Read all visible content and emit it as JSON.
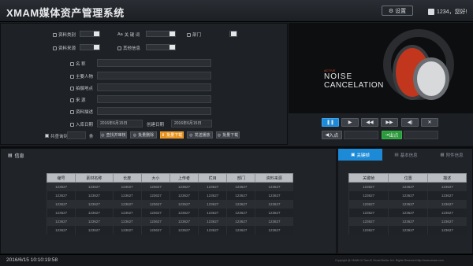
{
  "header": {
    "title": "XMAM媒体资产管理系统",
    "settings_label": "设置",
    "user_label": "1234，您好!"
  },
  "filters": {
    "type_label": "资料类别",
    "keyword_label": "关 键 词",
    "department_label": "部门",
    "source_label": "资料来源",
    "other_label": "其他信息"
  },
  "fields": [
    {
      "label": "名    称",
      "icon": "name-icon"
    },
    {
      "label": "主要人物",
      "icon": "person-icon"
    },
    {
      "label": "拍摄地点",
      "icon": "location-icon"
    },
    {
      "label": "来    源",
      "icon": "source-icon"
    },
    {
      "label": "资料描述",
      "icon": "description-icon"
    }
  ],
  "date": {
    "label": "入库日期",
    "from": "2016年6月15日",
    "to_label": "创建日期",
    "to": "2016年6月15日"
  },
  "summary": {
    "label": "共查询到",
    "unit": "条"
  },
  "actions": [
    "查找并审核",
    "批量删除",
    "批量下载",
    "发送播放",
    "批量下载"
  ],
  "video": {
    "overlay_small": "ACTIVE",
    "overlay_line1": "NOISE",
    "overlay_line2": "CANCELATION"
  },
  "controls": {
    "in_label": "入点",
    "out_label": "出点"
  },
  "info": {
    "title": "信息",
    "columns": [
      "编号",
      "素材名称",
      "长度",
      "大小",
      "上传者",
      "栏目",
      "部门",
      "资料来源"
    ],
    "rows": [
      [
        "123627",
        "123627",
        "123627",
        "123627",
        "123627",
        "123627",
        "123627",
        "123627"
      ],
      [
        "123627",
        "123627",
        "123627",
        "123627",
        "123627",
        "123627",
        "123627",
        "123627"
      ],
      [
        "123627",
        "123627",
        "123627",
        "123627",
        "123627",
        "123627",
        "123627",
        "123627"
      ],
      [
        "123627",
        "123627",
        "123627",
        "123627",
        "123627",
        "123627",
        "123627",
        "123627"
      ],
      [
        "123627",
        "123627",
        "123627",
        "123627",
        "123627",
        "123627",
        "123627",
        "123627"
      ],
      [
        "123627",
        "123627",
        "123627",
        "123627",
        "123627",
        "123627",
        "123627",
        "123627"
      ]
    ]
  },
  "right": {
    "tabs": [
      "关键帧",
      "基本信息",
      "附件信息"
    ],
    "columns": [
      "关键帧",
      "位置",
      "描述"
    ],
    "rows": [
      [
        "123627",
        "123627",
        "123627"
      ],
      [
        "123627",
        "123627",
        "123627"
      ],
      [
        "123627",
        "123627",
        "123627"
      ],
      [
        "123627",
        "123627",
        "123627"
      ],
      [
        "123627",
        "123627",
        "123627"
      ],
      [
        "123627",
        "123627",
        "123627"
      ]
    ]
  },
  "status": {
    "datetime": "2016/6/15   10:10:19:58",
    "copyright": "Copyright @ XMAM Xi Tian Di Visual Media. ALL Rights Reserved    http://www.xmam.com"
  }
}
